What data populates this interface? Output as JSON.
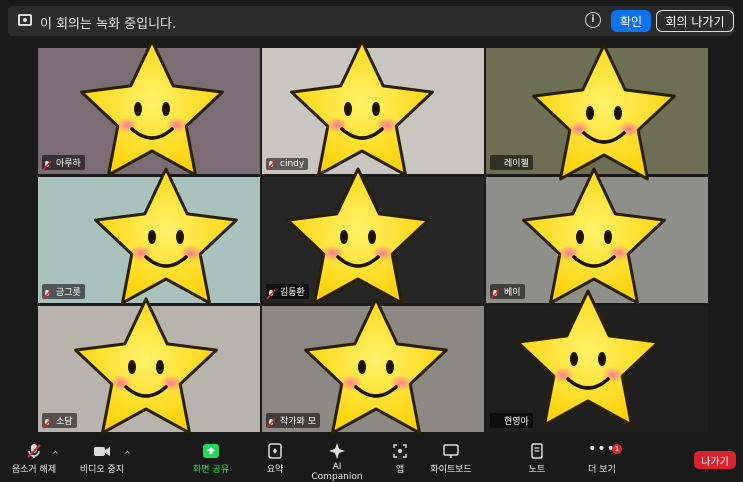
{
  "banner": {
    "message": "이 회의는 녹화 중입니다.",
    "info_icon": "info-icon",
    "ok_label": "확인",
    "leave_label": "회의 나가기"
  },
  "participants": [
    {
      "name": "아루하",
      "bg": "#7a6e74",
      "muted": true
    },
    {
      "name": "cindy",
      "bg": "#c9c6c2",
      "muted": true
    },
    {
      "name": "레이첼",
      "bg": "#6d6f55",
      "muted": false,
      "active": true
    },
    {
      "name": "금그릇",
      "bg": "#a9c2bd",
      "muted": true
    },
    {
      "name": "김동환",
      "bg": "#262626",
      "muted": true
    },
    {
      "name": "베이",
      "bg": "#8e8f8a",
      "muted": true
    },
    {
      "name": "소담",
      "bg": "#b8b4ad",
      "muted": true
    },
    {
      "name": "작가와 모",
      "bg": "#8c8984",
      "muted": true
    },
    {
      "name": "현영아",
      "bg": "#1f1f1f",
      "muted": false
    }
  ],
  "toolbar": {
    "mute": "음소거 해제",
    "video": "비디오 중지",
    "share": "화면 공유",
    "summary": "요약",
    "ai": "AI Companion",
    "apps": "앱",
    "whiteboard": "화이트보드",
    "notes": "노트",
    "more": "더 보기",
    "more_badge": "1",
    "end": "나가기"
  },
  "colors": {
    "accent": "#0e72ed",
    "share": "#23d959",
    "end": "#d9232e",
    "active_border": "#e5e58a"
  }
}
